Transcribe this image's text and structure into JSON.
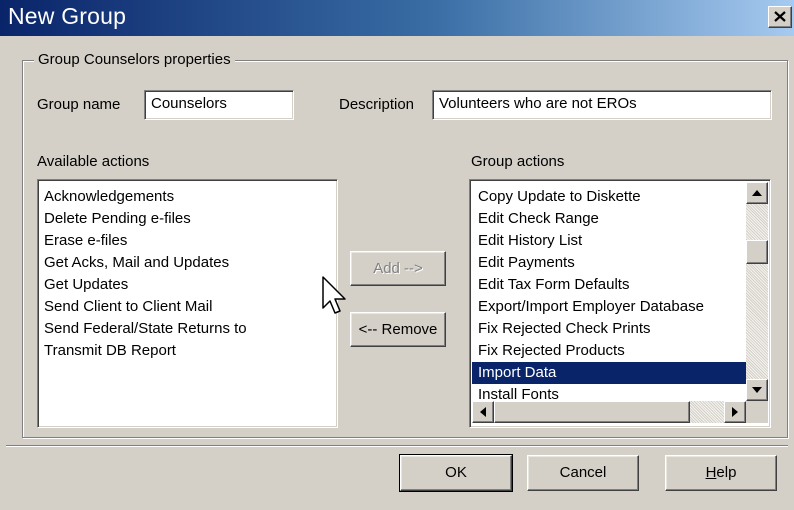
{
  "window": {
    "title": "New Group",
    "close_glyph": "✕"
  },
  "group": {
    "legend": "Group Counselors properties",
    "name_label": "Group name",
    "name_value": "Counselors",
    "description_label": "Description",
    "description_value": "Volunteers who are not EROs"
  },
  "available": {
    "label": "Available actions",
    "items": [
      "Acknowledgements",
      "Delete Pending e-files",
      "Erase e-files",
      "Get Acks, Mail and Updates",
      "Get Updates",
      "Send Client to Client Mail",
      "Send Federal/State Returns to",
      "Transmit DB Report"
    ]
  },
  "group_actions": {
    "label": "Group actions",
    "items": [
      "Copy Update to Diskette",
      "Edit Check Range",
      "Edit History List",
      "Edit Payments",
      "Edit Tax Form Defaults",
      "Export/Import Employer Database",
      "Fix Rejected Check Prints",
      "Fix Rejected Products",
      "Import Data",
      "Install Fonts"
    ],
    "selected": "Import Data"
  },
  "buttons": {
    "add": "Add -->",
    "remove": "<-- Remove",
    "ok": "OK",
    "cancel": "Cancel",
    "help_accel": "H",
    "help_rest": "elp"
  },
  "colors": {
    "title_start": "#0a246a",
    "title_end": "#a6caf0",
    "face": "#d4d0c8",
    "selection": "#0a246a"
  },
  "icons": {
    "close": "close-icon",
    "cursor": "mouse-pointer-icon"
  }
}
